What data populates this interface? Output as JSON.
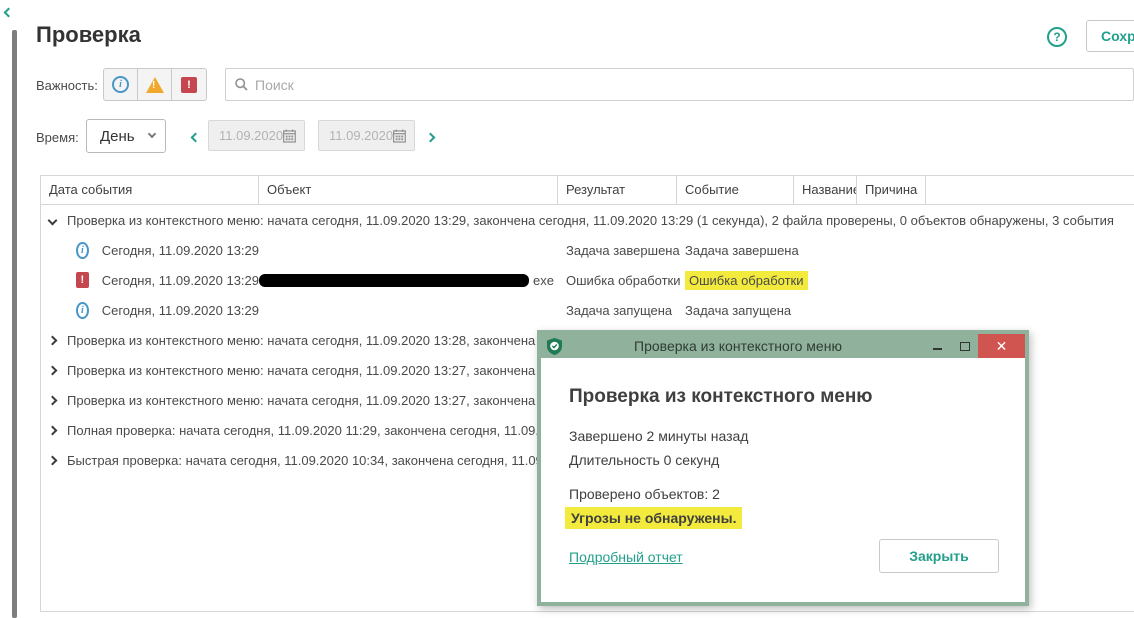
{
  "colors": {
    "accent_teal": "#23a08b",
    "dialog_titlebar_green": "#90b19c",
    "close_button_red": "#d0544f",
    "highlight_yellow": "#f2ea3c",
    "info_blue": "#4a96c8",
    "warning_amber": "#f0a92d",
    "error_red": "#c4464e"
  },
  "page": {
    "title": "Проверка",
    "save_button": "Сохранить",
    "help_icon": "?"
  },
  "filters": {
    "importance_label": "Важность:",
    "search_placeholder": "Поиск",
    "time_label": "Время:",
    "period_value": "День",
    "date_from": "11.09.2020",
    "date_to": "11.09.2020"
  },
  "table": {
    "columns": [
      "Дата события",
      "Объект",
      "Результат",
      "Событие",
      "Название",
      "Причина"
    ],
    "rows": [
      {
        "type": "group",
        "expanded": true,
        "text": "Проверка из контекстного меню: начата сегодня, 11.09.2020 13:29, закончена сегодня, 11.09.2020 13:29 (1 секунда), 2 файла проверены, 0 объектов обнаружены, 3 события"
      },
      {
        "type": "event",
        "severity": "info",
        "date": "Сегодня, 11.09.2020 13:29",
        "object": "",
        "result": "Задача завершена",
        "event": "Задача завершена"
      },
      {
        "type": "event",
        "severity": "error",
        "date": "Сегодня, 11.09.2020 13:29",
        "object_visible": "exe",
        "object_redacted": true,
        "result": "Ошибка обработки",
        "event": "Ошибка обработки",
        "event_highlighted": true
      },
      {
        "type": "event",
        "severity": "info",
        "date": "Сегодня, 11.09.2020 13:29",
        "object": "",
        "result": "Задача запущена",
        "event": "Задача запущена"
      },
      {
        "type": "group",
        "expanded": false,
        "text": "Проверка из контекстного меню: начата сегодня, 11.09.2020 13:28, закончена сегодня"
      },
      {
        "type": "group",
        "expanded": false,
        "text": "Проверка из контекстного меню: начата сегодня, 11.09.2020 13:27, закончена сегодня"
      },
      {
        "type": "group",
        "expanded": false,
        "text": "Проверка из контекстного меню: начата сегодня, 11.09.2020 13:27, закончена сегодня"
      },
      {
        "type": "group",
        "expanded": false,
        "text": "Полная проверка: начата сегодня, 11.09.2020 11:29, закончена сегодня, 11.09.2020 12:"
      },
      {
        "type": "group",
        "expanded": false,
        "text": "Быстрая проверка: начата сегодня, 11.09.2020 10:34, закончена сегодня, 11.09.2020 10"
      }
    ]
  },
  "dialog": {
    "titlebar": "Проверка из контекстного меню",
    "heading": "Проверка из контекстного меню",
    "completed": "Завершено 2 минуты назад",
    "duration": "Длительность 0 секунд",
    "objects_scanned": "Проверено объектов: 2",
    "threats": "Угрозы не обнаружены.",
    "report_link": "Подробный отчет",
    "close_button": "Закрыть",
    "close_x": "✕"
  }
}
